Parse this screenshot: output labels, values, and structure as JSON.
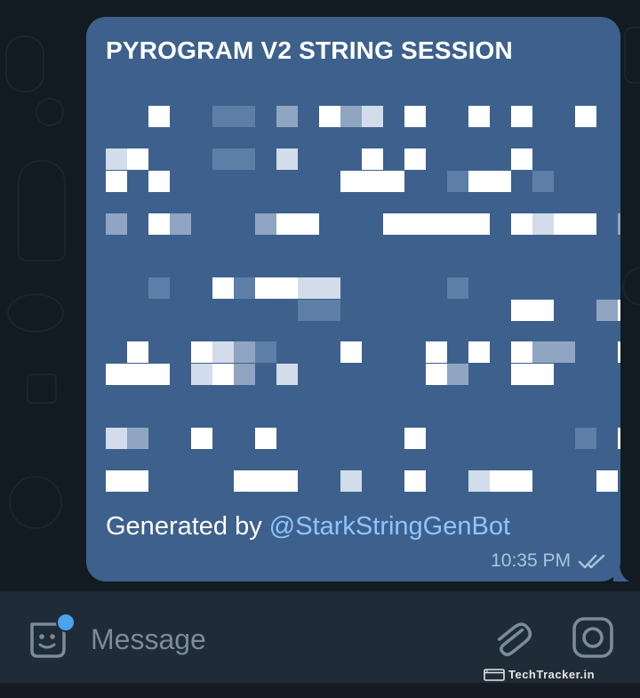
{
  "colors": {
    "background": "#121a22",
    "bubble": "#3d618c",
    "text": "#ffffff",
    "mention": "#8fc4ff",
    "meta": "#a8c4e0",
    "input_bar": "#1f2b37",
    "notify": "#4aa3ef"
  },
  "message": {
    "title": "PYROGRAM V2 STRING SESSION",
    "generated_prefix": "Generated by ",
    "mention": "@StarkStringGenBot",
    "time": "10:35 PM",
    "status_icon": "double-check-icon"
  },
  "composer": {
    "placeholder": "Message",
    "sticker_icon": "sticker-icon",
    "attach_icon": "paperclip-icon",
    "camera_icon": "camera-icon"
  },
  "watermark": {
    "text": "TechTracker.in",
    "icon": "browser-icon"
  }
}
